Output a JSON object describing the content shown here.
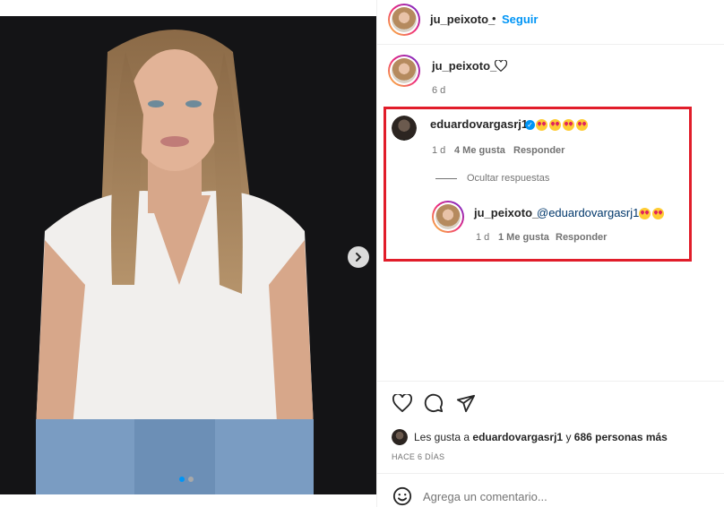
{
  "header": {
    "username": "ju_peixoto_",
    "separator": "•",
    "follow": "Seguir"
  },
  "caption": {
    "username": "ju_peixoto_",
    "time": "6 d"
  },
  "comment": {
    "username": "eduardovargasrj1",
    "time": "1 d",
    "likes": "4 Me gusta",
    "reply": "Responder",
    "hide_replies": "Ocultar respuestas",
    "emojis": [
      "heart-eyes",
      "heart-eyes",
      "heart-eyes",
      "heart-eyes"
    ]
  },
  "reply": {
    "username": "ju_peixoto_",
    "mention": "@eduardovargasrj1",
    "time": "1 d",
    "likes": "1 Me gusta",
    "reply": "Responder",
    "emojis": [
      "smiling-face-with-hearts",
      "smiling-face-with-hearts"
    ]
  },
  "actions": {
    "icons": [
      "heart-icon",
      "comment-icon",
      "share-icon"
    ]
  },
  "likes_line": {
    "prefix": "Les gusta a",
    "user": "eduardovargasrj1",
    "middle": "y",
    "others": "686 personas más"
  },
  "post_age": "HACE 6 DÍAS",
  "comment_input": {
    "placeholder": "Agrega un comentario..."
  },
  "colors": {
    "accent": "#0095f6",
    "highlight": "#e11d2a",
    "muted": "#737373"
  }
}
